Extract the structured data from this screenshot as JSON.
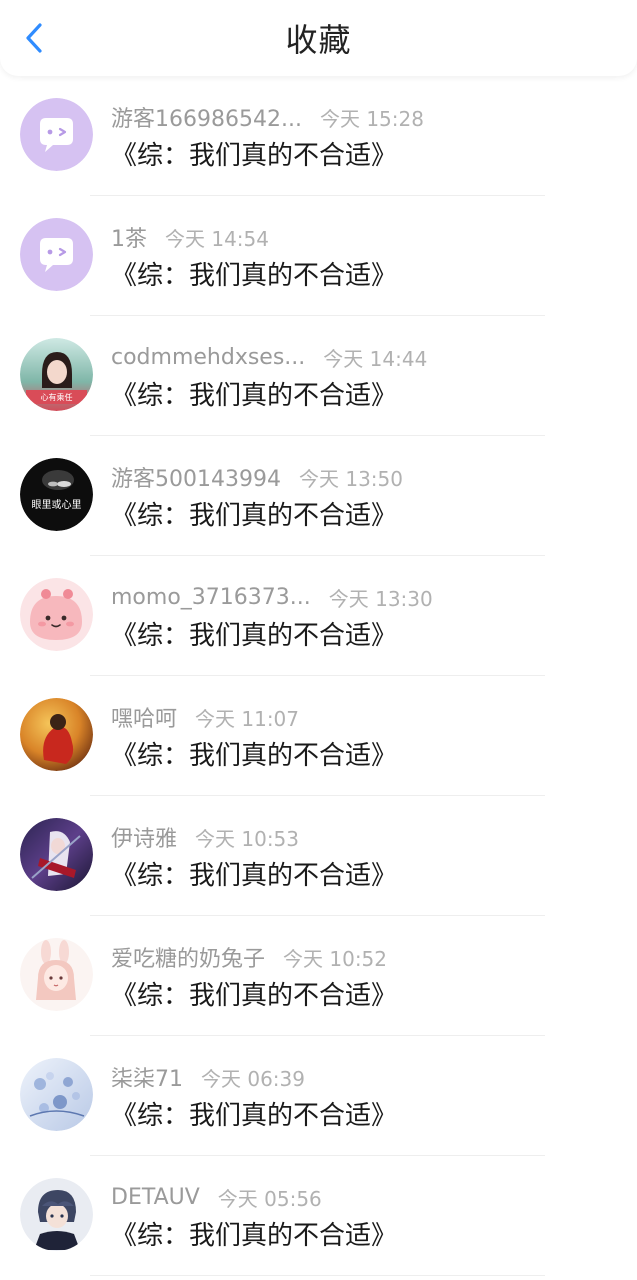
{
  "header": {
    "title": "收藏",
    "back_icon": "chevron-left-icon",
    "accent": "#2f8cff"
  },
  "items": [
    {
      "username": "游客166986542...",
      "time": "今天 15:28",
      "book": "《综：我们真的不合适》",
      "avatar": "default-chat-avatar"
    },
    {
      "username": "1茶",
      "time": "今天 14:54",
      "book": "《综：我们真的不合适》",
      "avatar": "default-chat-avatar"
    },
    {
      "username": "codmmehdxses...",
      "time": "今天 14:44",
      "book": "《综：我们真的不合适》",
      "avatar": "girl-portrait-avatar",
      "avatar_caption": "心有乘任"
    },
    {
      "username": "游客500143994",
      "time": "今天 13:50",
      "book": "《综：我们真的不合适》",
      "avatar": "dark-portrait-avatar",
      "avatar_caption": "眼里或心里"
    },
    {
      "username": "momo_3716373...",
      "time": "今天 13:30",
      "book": "《综：我们真的不合适》",
      "avatar": "pink-cartoon-avatar"
    },
    {
      "username": "嘿哈呵",
      "time": "今天 11:07",
      "book": "《综：我们真的不合适》",
      "avatar": "red-figure-avatar"
    },
    {
      "username": "伊诗雅",
      "time": "今天 10:53",
      "book": "《综：我们真的不合适》",
      "avatar": "anime-warrior-avatar"
    },
    {
      "username": "爱吃糖的奶兔子",
      "time": "今天 10:52",
      "book": "《综：我们真的不合适》",
      "avatar": "bunny-girl-avatar"
    },
    {
      "username": "柒柒71",
      "time": "今天 06:39",
      "book": "《综：我们真的不合适》",
      "avatar": "blue-floral-avatar"
    },
    {
      "username": "DETAUV",
      "time": "今天 05:56",
      "book": "《综：我们真的不合适》",
      "avatar": "anime-boy-avatar"
    }
  ]
}
